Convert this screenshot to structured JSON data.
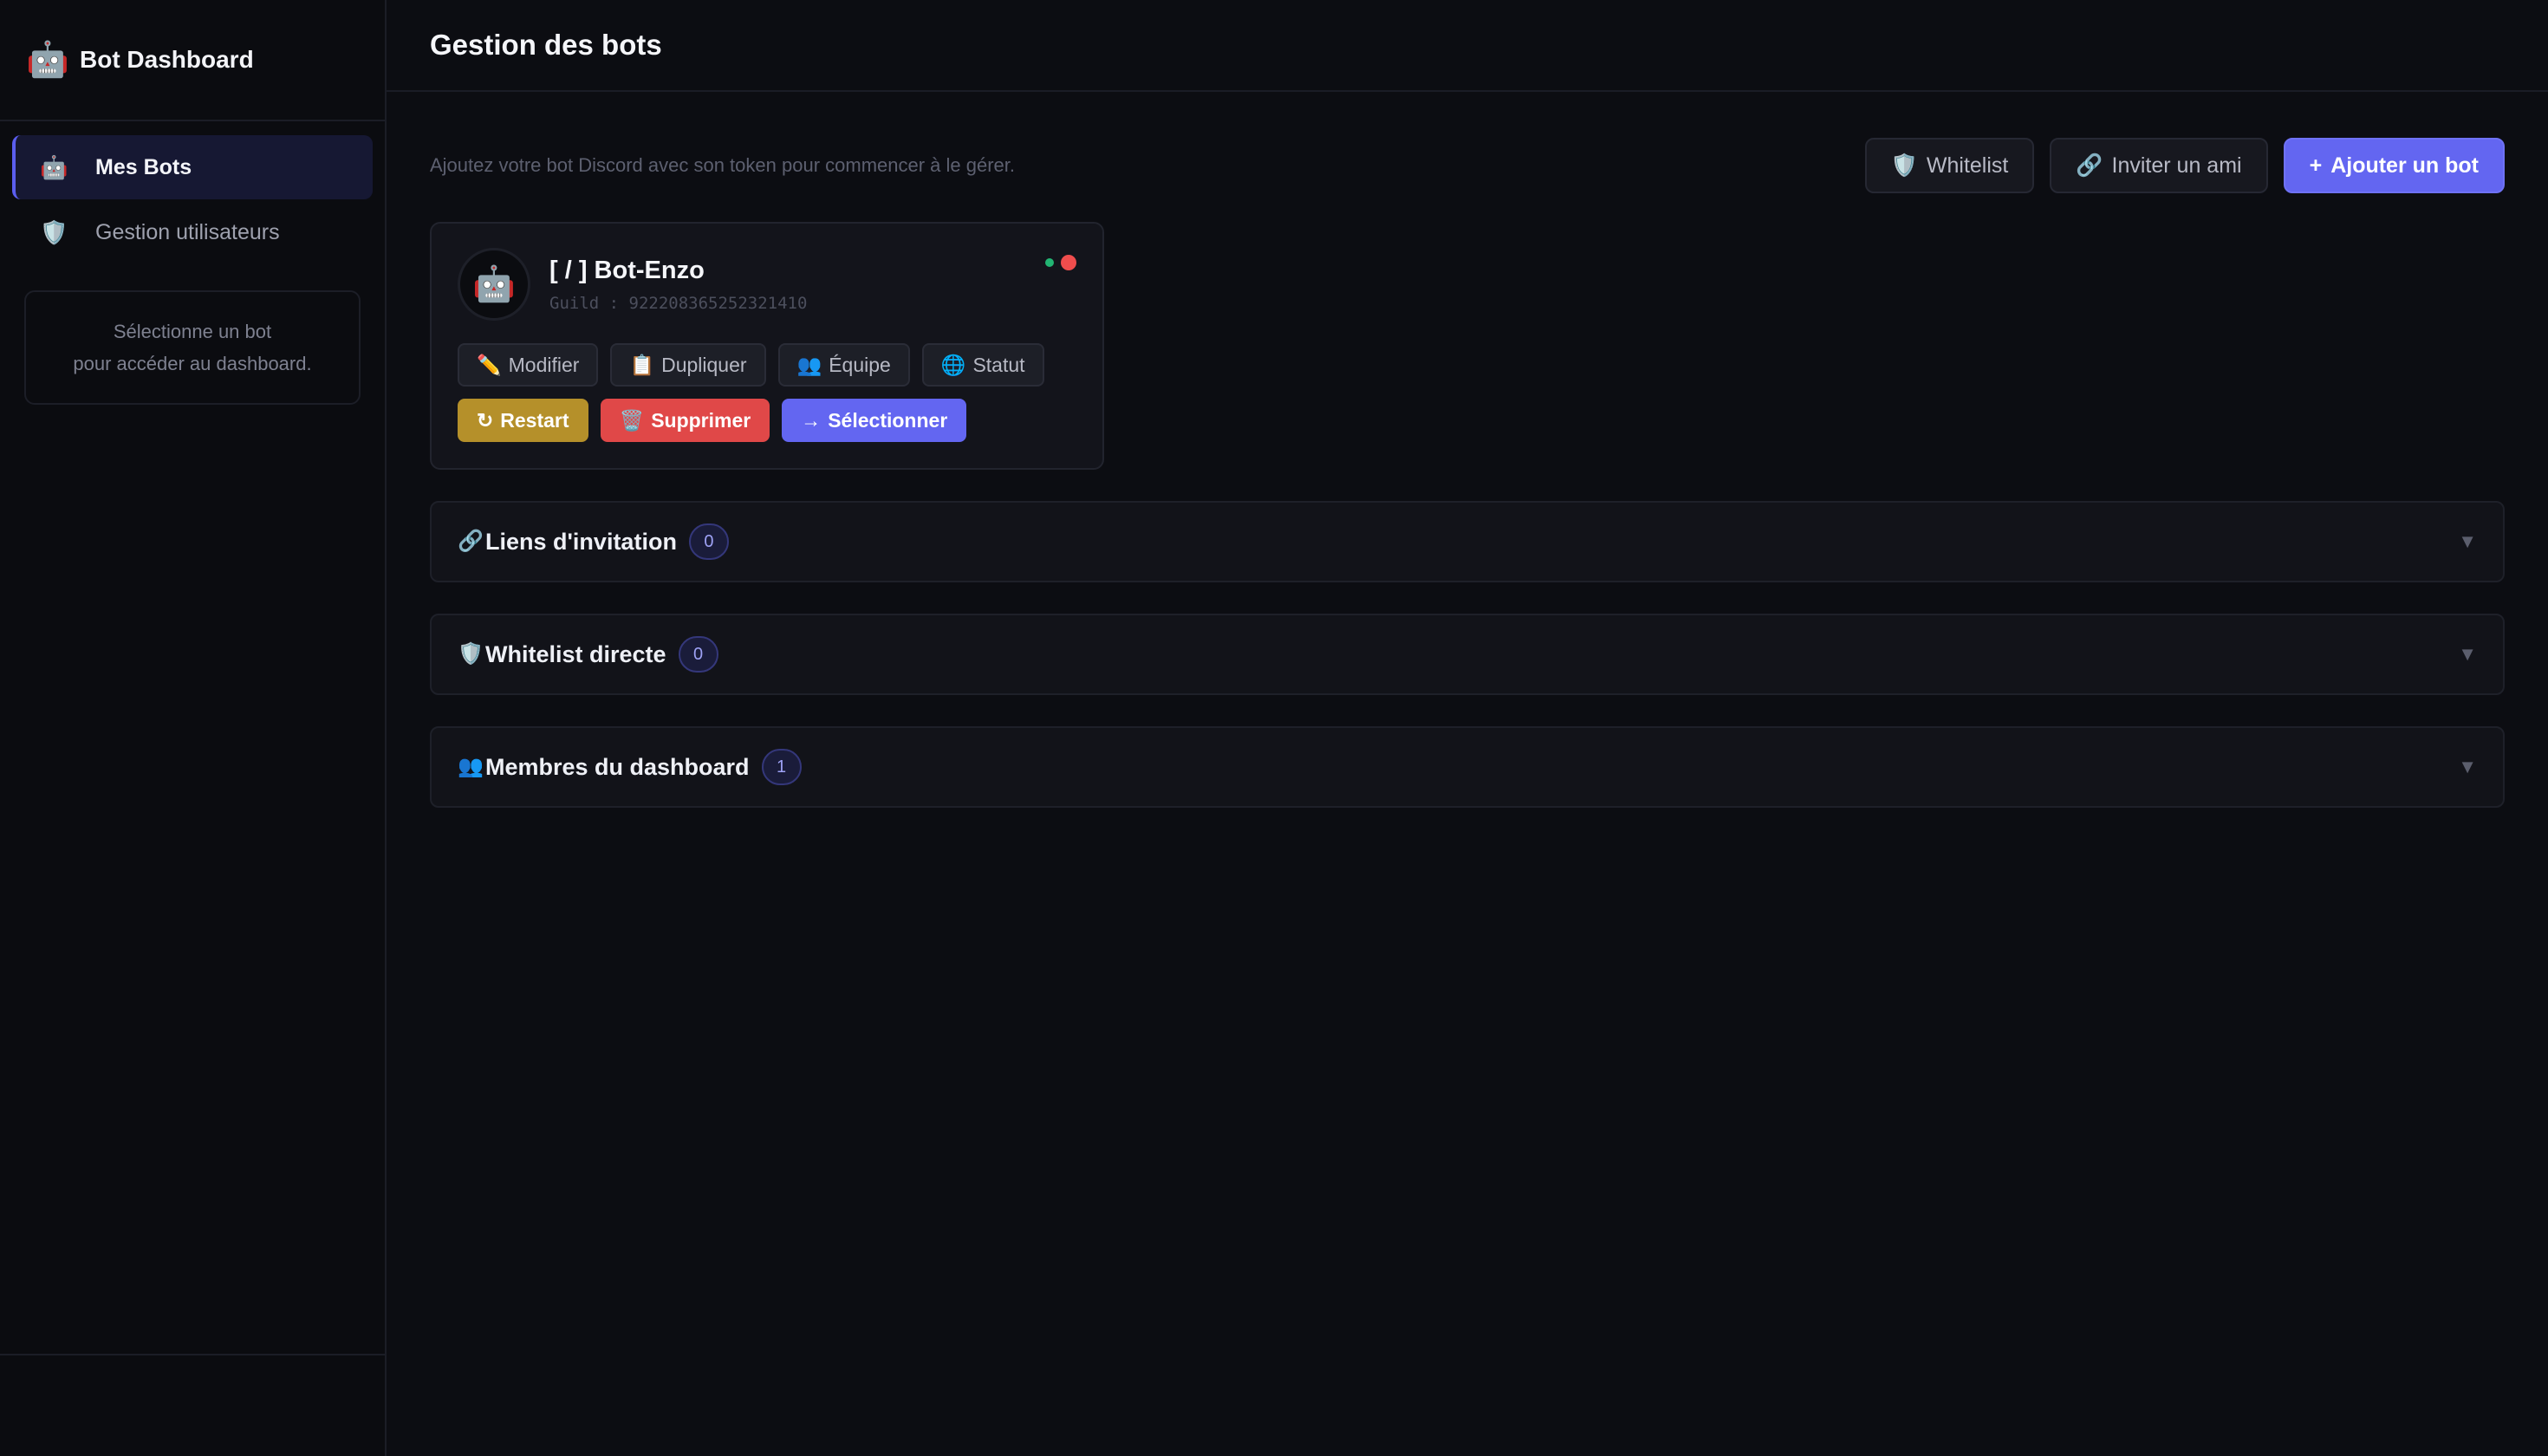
{
  "sidebar": {
    "brand": {
      "icon": "🤖",
      "title": "Bot Dashboard"
    },
    "items": [
      {
        "icon": "🤖",
        "label": "Mes Bots",
        "active": true
      },
      {
        "icon": "🛡️",
        "label": "Gestion utilisateurs",
        "active": false
      }
    ],
    "hint": {
      "line1": "Sélectionne un bot",
      "line2": "pour accéder au dashboard."
    }
  },
  "header": {
    "title": "Gestion des bots"
  },
  "toolbar": {
    "subtitle": "Ajoutez votre bot Discord avec son token pour commencer à le gérer.",
    "whitelist": {
      "icon": "🛡️",
      "label": "Whitelist"
    },
    "invite": {
      "icon": "🔗",
      "label": "Inviter un ami"
    },
    "add": {
      "icon": "+",
      "label": "Ajouter un bot"
    }
  },
  "bot": {
    "avatar": "🤖",
    "name": "[ / ] Bot-Enzo",
    "guild": "Guild : 922208365252321410",
    "actions": {
      "modifier": {
        "icon": "✏️",
        "label": "Modifier"
      },
      "dupliquer": {
        "icon": "📋",
        "label": "Dupliquer"
      },
      "equipe": {
        "icon": "👥",
        "label": "Équipe"
      },
      "statut": {
        "icon": "🌐",
        "label": "Statut"
      },
      "restart": {
        "icon": "↻",
        "label": "Restart"
      },
      "supprimer": {
        "icon": "🗑️",
        "label": "Supprimer"
      },
      "selectionner": {
        "icon": "→",
        "label": "Sélectionner"
      }
    },
    "colors": {
      "online": "#22b573",
      "offline": "#ef4d4d"
    }
  },
  "panels": [
    {
      "icon": "🔗",
      "title": "Liens d'invitation",
      "count": "0"
    },
    {
      "icon": "🛡️",
      "title": "Whitelist directe",
      "count": "0"
    },
    {
      "icon": "👥",
      "title": "Membres du dashboard",
      "count": "1"
    }
  ],
  "chevron": "▼",
  "accent": "#6366f1"
}
